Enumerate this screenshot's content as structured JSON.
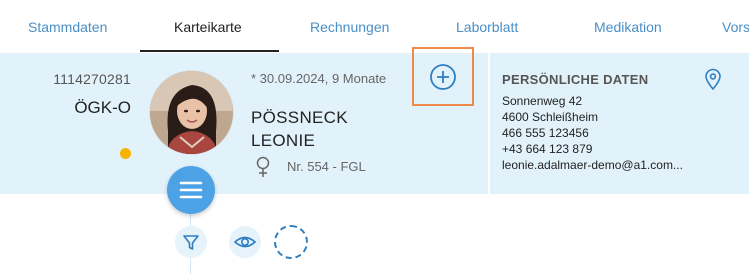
{
  "tabs": [
    {
      "label": "Stammdaten",
      "active": false
    },
    {
      "label": "Karteikarte",
      "active": true
    },
    {
      "label": "Rechnungen",
      "active": false
    },
    {
      "label": "Laborblatt",
      "active": false
    },
    {
      "label": "Medikation",
      "active": false
    },
    {
      "label": "Vors",
      "active": false
    }
  ],
  "patient": {
    "id": "1114270281",
    "insurer": "ÖGK-O",
    "birth_info": "* 30.09.2024, 9 Monate",
    "last_name": "PÖSSNECK",
    "first_name": "LEONIE",
    "gender": "female-icon",
    "record_number": "Nr. 554 - FGL",
    "status_color": "#f5b400"
  },
  "personal_data": {
    "title": "PERSÖNLICHE DATEN",
    "street": "Sonnenweg 42",
    "city": "4600 Schleißheim",
    "phone": "466 555 123456",
    "mobile": "+43 664 123 879",
    "email": "leonie.adalmaer-demo@a1.com..."
  },
  "icons": {
    "add": "add-circle-icon",
    "location": "map-pin-icon",
    "menu": "menu-icon",
    "filter": "filter-icon",
    "view": "eye-icon"
  },
  "colors": {
    "accent": "#4da2e6",
    "tab_text": "#4a8fc7",
    "band_bg": "#e2f2fb",
    "highlight_frame": "#f08a4b"
  }
}
